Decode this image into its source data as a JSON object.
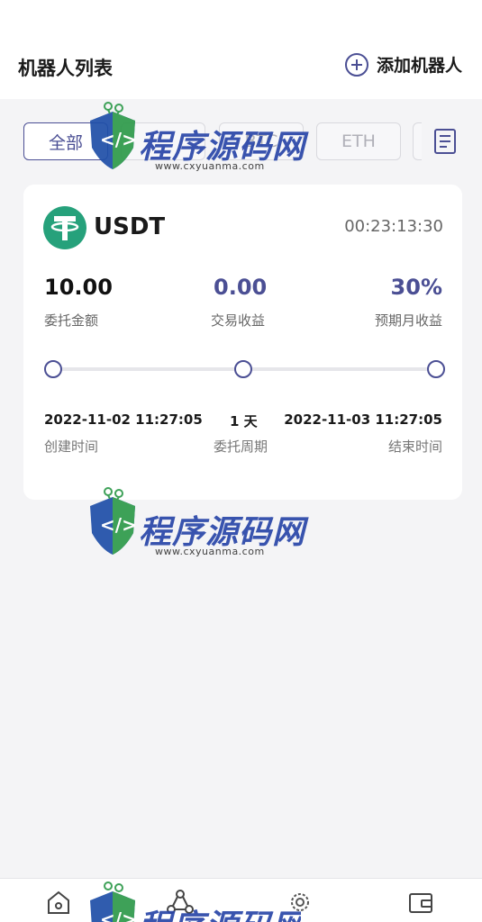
{
  "header": {
    "title": "机器人列表",
    "add_label": "添加机器人"
  },
  "tabs": [
    {
      "label": "全部",
      "active": true
    },
    {
      "label": "",
      "active": false
    },
    {
      "label": "BTC",
      "active": false
    },
    {
      "label": "ETH",
      "active": false
    },
    {
      "label": "",
      "active": false
    }
  ],
  "card": {
    "coin": "USDT",
    "timer": "00:23:13:30",
    "amount": {
      "value": "10.00",
      "label": "委托金额"
    },
    "profit": {
      "value": "0.00",
      "label": "交易收益"
    },
    "expected": {
      "value": "30%",
      "label": "预期月收益"
    },
    "start": {
      "value": "2022-11-02 11:27:05",
      "label": "创建时间"
    },
    "period": {
      "value": "1 天",
      "label": "委托周期"
    },
    "end": {
      "value": "2022-11-03 11:27:05",
      "label": "结束时间"
    }
  },
  "watermark": {
    "text": "程序源码网",
    "url": "www.cxyuanma.com"
  },
  "bottom_nav": [
    {
      "icon": "home-icon"
    },
    {
      "icon": "share-nodes-icon"
    },
    {
      "icon": "robot-gear-icon"
    },
    {
      "icon": "wallet-icon"
    }
  ],
  "colors": {
    "accent": "#4b4f94",
    "usdt_green": "#26a17b",
    "watermark_blue": "#2946a8"
  }
}
